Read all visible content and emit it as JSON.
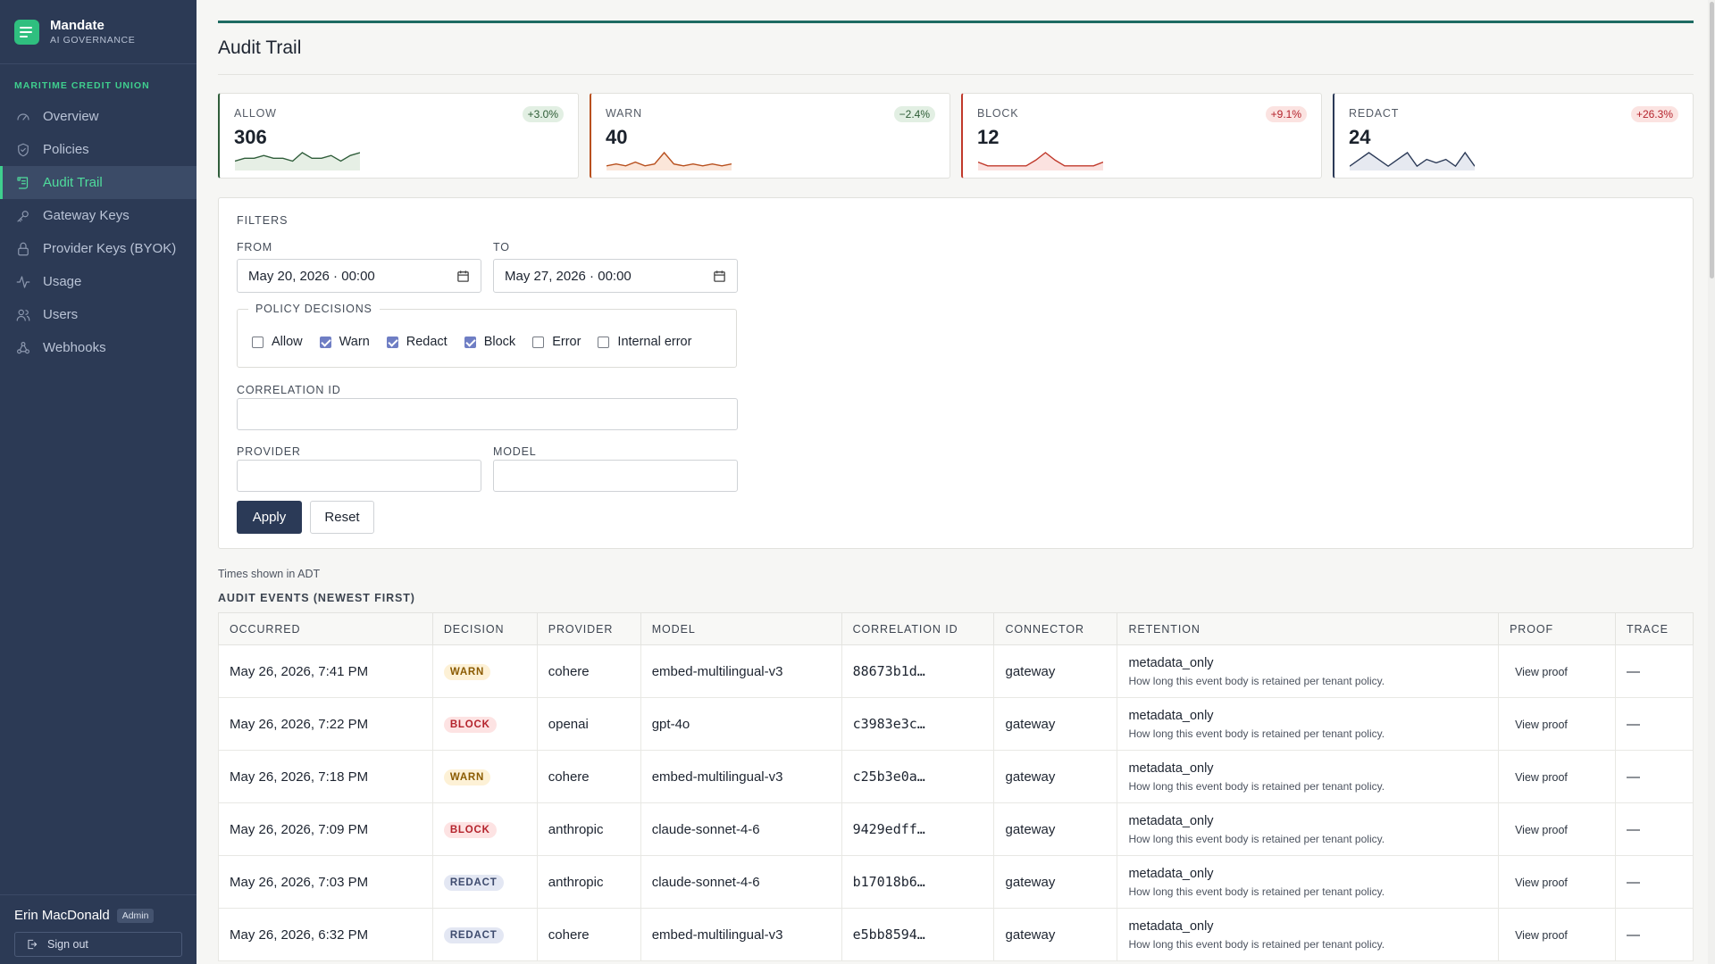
{
  "brand": {
    "name": "Mandate",
    "subtitle": "AI GOVERNANCE"
  },
  "org_name": "MARITIME CREDIT UNION",
  "nav": [
    {
      "label": "Overview",
      "icon": "gauge-icon",
      "active": false
    },
    {
      "label": "Policies",
      "icon": "shield-icon",
      "active": false
    },
    {
      "label": "Audit Trail",
      "icon": "scroll-icon",
      "active": true
    },
    {
      "label": "Gateway Keys",
      "icon": "key-icon",
      "active": false
    },
    {
      "label": "Provider Keys (BYOK)",
      "icon": "lock-icon",
      "active": false
    },
    {
      "label": "Usage",
      "icon": "activity-icon",
      "active": false
    },
    {
      "label": "Users",
      "icon": "users-icon",
      "active": false
    },
    {
      "label": "Webhooks",
      "icon": "webhook-icon",
      "active": false
    }
  ],
  "user": {
    "name": "Erin MacDonald",
    "role": "Admin",
    "signout_label": "Sign out"
  },
  "page_title": "Audit Trail",
  "stats": [
    {
      "label": "ALLOW",
      "value": "306",
      "delta": "+3.0%",
      "color": "#2f5d3a",
      "delta_bg": "#e2efe3",
      "delta_color": "#2c5b34",
      "fill": "#e6efe5",
      "spark": [
        3,
        4,
        4,
        5,
        4,
        4,
        3,
        6,
        4,
        4,
        5,
        3,
        5,
        6
      ]
    },
    {
      "label": "WARN",
      "value": "40",
      "delta": "−2.4%",
      "color": "#b8501e",
      "delta_bg": "#e2efe3",
      "delta_color": "#2c5b34",
      "fill": "#fbe6d9",
      "spark": [
        2,
        3,
        2,
        4,
        2,
        3,
        9,
        3,
        2,
        3,
        2,
        3,
        2,
        3
      ]
    },
    {
      "label": "BLOCK",
      "value": "12",
      "delta": "+9.1%",
      "color": "#c0392b",
      "delta_bg": "#fbe3e1",
      "delta_color": "#b4232c",
      "fill": "#fbe2e0",
      "spark": [
        4,
        2,
        2,
        2,
        2,
        2,
        5,
        9,
        5,
        2,
        2,
        2,
        2,
        4
      ]
    },
    {
      "label": "REDACT",
      "value": "24",
      "delta": "+26.3%",
      "color": "#2b3a57",
      "delta_bg": "#fbe3e1",
      "delta_color": "#b4232c",
      "fill": "#e6e9f0",
      "spark": [
        2,
        6,
        10,
        6,
        2,
        6,
        10,
        2,
        6,
        4,
        6,
        2,
        10,
        2
      ]
    }
  ],
  "filters": {
    "title": "FILTERS",
    "from_label": "FROM",
    "from_value": "May 20, 2026 · 00:00",
    "to_label": "TO",
    "to_value": "May 27, 2026 · 00:00",
    "decisions_legend": "POLICY DECISIONS",
    "decisions": [
      {
        "label": "Allow",
        "checked": false
      },
      {
        "label": "Warn",
        "checked": true
      },
      {
        "label": "Redact",
        "checked": true
      },
      {
        "label": "Block",
        "checked": true
      },
      {
        "label": "Error",
        "checked": false
      },
      {
        "label": "Internal error",
        "checked": false
      }
    ],
    "correlation_label": "CORRELATION ID",
    "correlation_value": "",
    "provider_label": "PROVIDER",
    "provider_value": "",
    "model_label": "MODEL",
    "model_value": "",
    "apply_label": "Apply",
    "reset_label": "Reset"
  },
  "tz_note": "Times shown in ADT",
  "events_title": "AUDIT EVENTS (NEWEST FIRST)",
  "columns": [
    "OCCURRED",
    "DECISION",
    "PROVIDER",
    "MODEL",
    "CORRELATION ID",
    "CONNECTOR",
    "RETENTION",
    "PROOF",
    "TRACE"
  ],
  "rows": [
    {
      "occurred": "May 26, 2026, 7:41 PM",
      "decision": "WARN",
      "provider": "cohere",
      "model": "embed-multilingual-v3",
      "correlation": "88673b1d…",
      "connector": "gateway",
      "retention": "metadata_only",
      "retention_note": "How long this event body is retained per tenant policy.",
      "proof": "View proof",
      "trace": "—"
    },
    {
      "occurred": "May 26, 2026, 7:22 PM",
      "decision": "BLOCK",
      "provider": "openai",
      "model": "gpt-4o",
      "correlation": "c3983e3c…",
      "connector": "gateway",
      "retention": "metadata_only",
      "retention_note": "How long this event body is retained per tenant policy.",
      "proof": "View proof",
      "trace": "—"
    },
    {
      "occurred": "May 26, 2026, 7:18 PM",
      "decision": "WARN",
      "provider": "cohere",
      "model": "embed-multilingual-v3",
      "correlation": "c25b3e0a…",
      "connector": "gateway",
      "retention": "metadata_only",
      "retention_note": "How long this event body is retained per tenant policy.",
      "proof": "View proof",
      "trace": "—"
    },
    {
      "occurred": "May 26, 2026, 7:09 PM",
      "decision": "BLOCK",
      "provider": "anthropic",
      "model": "claude-sonnet-4-6",
      "correlation": "9429edff…",
      "connector": "gateway",
      "retention": "metadata_only",
      "retention_note": "How long this event body is retained per tenant policy.",
      "proof": "View proof",
      "trace": "—"
    },
    {
      "occurred": "May 26, 2026, 7:03 PM",
      "decision": "REDACT",
      "provider": "anthropic",
      "model": "claude-sonnet-4-6",
      "correlation": "b17018b6…",
      "connector": "gateway",
      "retention": "metadata_only",
      "retention_note": "How long this event body is retained per tenant policy.",
      "proof": "View proof",
      "trace": "—"
    },
    {
      "occurred": "May 26, 2026, 6:32 PM",
      "decision": "REDACT",
      "provider": "cohere",
      "model": "embed-multilingual-v3",
      "correlation": "e5bb8594…",
      "connector": "gateway",
      "retention": "metadata_only",
      "retention_note": "How long this event body is retained per tenant policy.",
      "proof": "View proof",
      "trace": "—"
    }
  ]
}
